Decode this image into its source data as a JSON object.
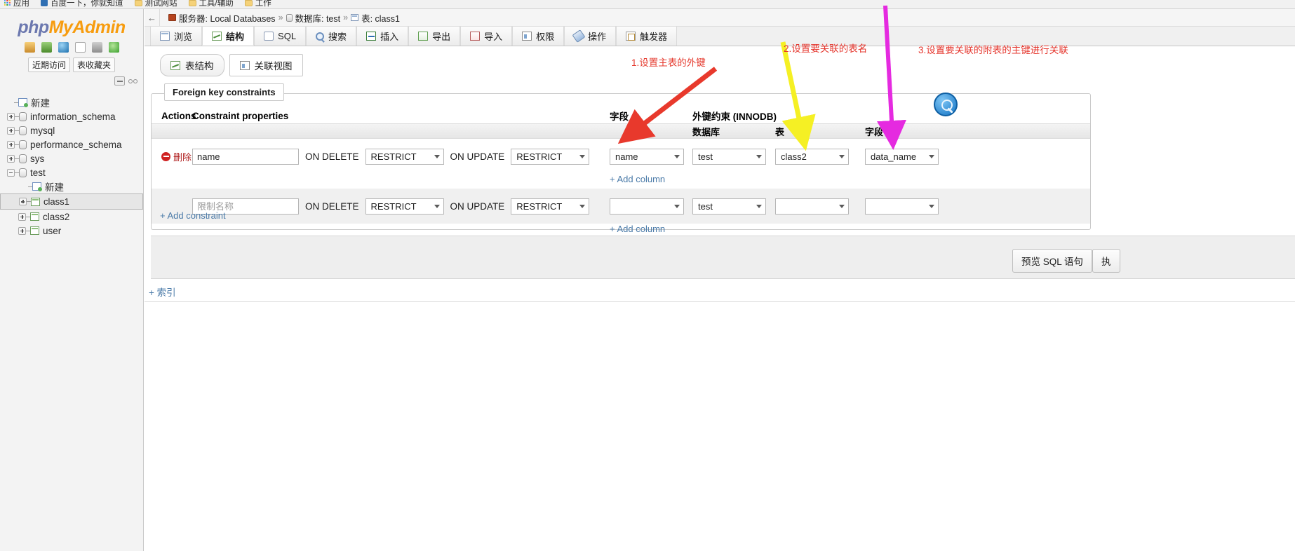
{
  "browser": {
    "bookmarks": [
      {
        "icon": "apps-grid-icon",
        "label": "应用"
      },
      {
        "icon": "baidu-favicon",
        "label": "百度一下，你就知道"
      },
      {
        "icon": "folder-icon",
        "label": "测试网站"
      },
      {
        "icon": "folder-icon",
        "label": "工具/辅助"
      },
      {
        "icon": "folder-icon",
        "label": "工作"
      }
    ]
  },
  "sidebar": {
    "logo": {
      "part1": "php",
      "part2": "My",
      "part3": "Admin"
    },
    "logo_icons": [
      "home-icon",
      "exit-icon",
      "globe-icon",
      "docs-icon",
      "settings-icon",
      "refresh-icon"
    ],
    "quick_tabs": [
      {
        "label": "近期访问"
      },
      {
        "label": "表收藏夹"
      }
    ],
    "collapse_icons": [
      "collapse-icon",
      "link-chain-icon"
    ],
    "tree": [
      {
        "label": "新建",
        "level": 1,
        "toggle": "none",
        "icon": "new-db-icon",
        "selected": false
      },
      {
        "label": "information_schema",
        "level": 1,
        "toggle": "plus",
        "icon": "database-icon",
        "selected": false
      },
      {
        "label": "mysql",
        "level": 1,
        "toggle": "plus",
        "icon": "database-icon",
        "selected": false
      },
      {
        "label": "performance_schema",
        "level": 1,
        "toggle": "plus",
        "icon": "database-icon",
        "selected": false
      },
      {
        "label": "sys",
        "level": 1,
        "toggle": "plus",
        "icon": "database-icon",
        "selected": false
      },
      {
        "label": "test",
        "level": 1,
        "toggle": "minus",
        "icon": "database-icon",
        "selected": false
      },
      {
        "label": "新建",
        "level": 2,
        "toggle": "none",
        "icon": "new-table-icon",
        "selected": false
      },
      {
        "label": "class1",
        "level": 2,
        "toggle": "plus",
        "icon": "table-icon",
        "selected": true
      },
      {
        "label": "class2",
        "level": 2,
        "toggle": "plus",
        "icon": "table-icon",
        "selected": false
      },
      {
        "label": "user",
        "level": 2,
        "toggle": "plus",
        "icon": "table-icon",
        "selected": false
      }
    ]
  },
  "breadcrumb": {
    "back_glyph": "←",
    "items": [
      {
        "icon": "server-icon",
        "label": "服务器: Local Databases"
      },
      {
        "icon": "database-icon",
        "label": "数据库: test"
      },
      {
        "icon": "table-icon",
        "label": "表: class1"
      }
    ],
    "separator": "»"
  },
  "tabs": [
    {
      "label": "浏览",
      "icon": "browse-icon",
      "active": false
    },
    {
      "label": "结构",
      "icon": "structure-icon",
      "active": true
    },
    {
      "label": "SQL",
      "icon": "sql-icon",
      "active": false
    },
    {
      "label": "搜索",
      "icon": "search-icon",
      "active": false
    },
    {
      "label": "插入",
      "icon": "insert-icon",
      "active": false
    },
    {
      "label": "导出",
      "icon": "export-icon",
      "active": false
    },
    {
      "label": "导入",
      "icon": "import-icon",
      "active": false
    },
    {
      "label": "权限",
      "icon": "privileges-icon",
      "active": false
    },
    {
      "label": "操作",
      "icon": "operations-icon",
      "active": false
    },
    {
      "label": "触发器",
      "icon": "triggers-icon",
      "active": false
    }
  ],
  "subtabs": [
    {
      "label": "表结构",
      "icon": "structure-icon",
      "active": true
    },
    {
      "label": "关联视图",
      "icon": "relation-view-icon",
      "active": false
    }
  ],
  "fieldset": {
    "legend": "Foreign key constraints",
    "headers": {
      "actions": "Actions",
      "constraint_properties": "Constraint properties",
      "column": "字段",
      "column_help_icon": "help-icon",
      "foreign_key_constraint": "外键约束 (INNODB)"
    },
    "subheaders": {
      "database": "数据库",
      "table": "表",
      "field": "字段"
    },
    "rows": [
      {
        "delete_label": "删除",
        "delete_icon": "delete-icon",
        "constraint_name": "name",
        "constraint_name_placeholder": "",
        "on_delete_label": "ON DELETE",
        "on_delete_value": "RESTRICT",
        "on_update_label": "ON UPDATE",
        "on_update_value": "RESTRICT",
        "column": "name",
        "database": "test",
        "table": "class2",
        "field": "data_name",
        "add_column": "+ Add column",
        "style": "white"
      },
      {
        "delete_label": "",
        "delete_icon": "",
        "constraint_name": "",
        "constraint_name_placeholder": "限制名称",
        "on_delete_label": "ON DELETE",
        "on_delete_value": "RESTRICT",
        "on_update_label": "ON UPDATE",
        "on_update_value": "RESTRICT",
        "column": "",
        "database": "test",
        "table": "",
        "field": "",
        "add_column": "+ Add column",
        "style": "alt"
      }
    ],
    "add_constraint": "+ Add constraint",
    "select_caret": "▾"
  },
  "footer": {
    "preview_sql": "预览 SQL 语句",
    "go": "执"
  },
  "index_link": "+ 索引",
  "magnifier_icon": "magnifier-icon",
  "annotations": [
    {
      "id": "anno-1",
      "text": "1.设置主表的外键",
      "color": "#e53a2e",
      "arrow_color": "#e8392c"
    },
    {
      "id": "anno-2",
      "text": "2.设置要关联的表名",
      "color": "#e5352c",
      "arrow_color": "#f5f024"
    },
    {
      "id": "anno-3",
      "text": "3.设置要关联的附表的主键进行关联",
      "color": "#e5352c",
      "arrow_color": "#e52ae0"
    }
  ]
}
